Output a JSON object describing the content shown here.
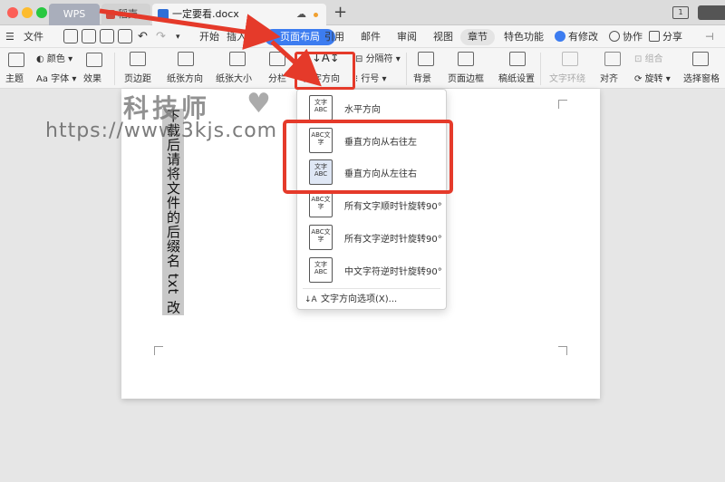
{
  "titlebar": {
    "app_tab": "WPS",
    "tab2_label": "稻壳",
    "active_doc": "一定要看.docx",
    "new_tab": "+",
    "window_ctrl": "1"
  },
  "menubar": {
    "file": "文件",
    "items": [
      "开始",
      "插入",
      "页面布局",
      "引用",
      "邮件",
      "审阅",
      "视图",
      "章节",
      "特色功能"
    ],
    "right": {
      "changes": "有修改",
      "collab": "协作",
      "share": "分享"
    }
  },
  "ribbon": {
    "theme": "主题",
    "color": "颜色",
    "font": "字体",
    "effect": "效果",
    "margins": "页边距",
    "orientation": "纸张方向",
    "size": "纸张大小",
    "columns": "分栏",
    "text_direction": "文字方向",
    "breaks": "分隔符",
    "line_numbers": "行号",
    "background": "背景",
    "page_border": "页面边框",
    "grid_settings": "稿纸设置",
    "text_wrap": "文字环绕",
    "align": "对齐",
    "group": "组合",
    "rotate": "旋转",
    "selection_pane": "选择窗格"
  },
  "document": {
    "vertical_text": "下载后请将文件的后缀名 txt 改成 iso"
  },
  "watermark": {
    "title": "科技师",
    "url": "https://www.3kjs.com"
  },
  "dropdown": {
    "items": [
      {
        "label": "水平方向",
        "icon_text": "文字ABC"
      },
      {
        "label": "垂直方向从右往左",
        "icon_text": "ABC文字"
      },
      {
        "label": "垂直方向从左往右",
        "icon_text": "文字ABC"
      },
      {
        "label": "所有文字顺时针旋转90°",
        "icon_text": "ABC文字"
      },
      {
        "label": "所有文字逆时针旋转90°",
        "icon_text": "ABC文字"
      },
      {
        "label": "中文字符逆时针旋转90°",
        "icon_text": "文字ABC"
      }
    ],
    "options": "文字方向选项(X)..."
  },
  "colors": {
    "accent": "#3c7cf0",
    "highlight": "#e53a2a"
  }
}
